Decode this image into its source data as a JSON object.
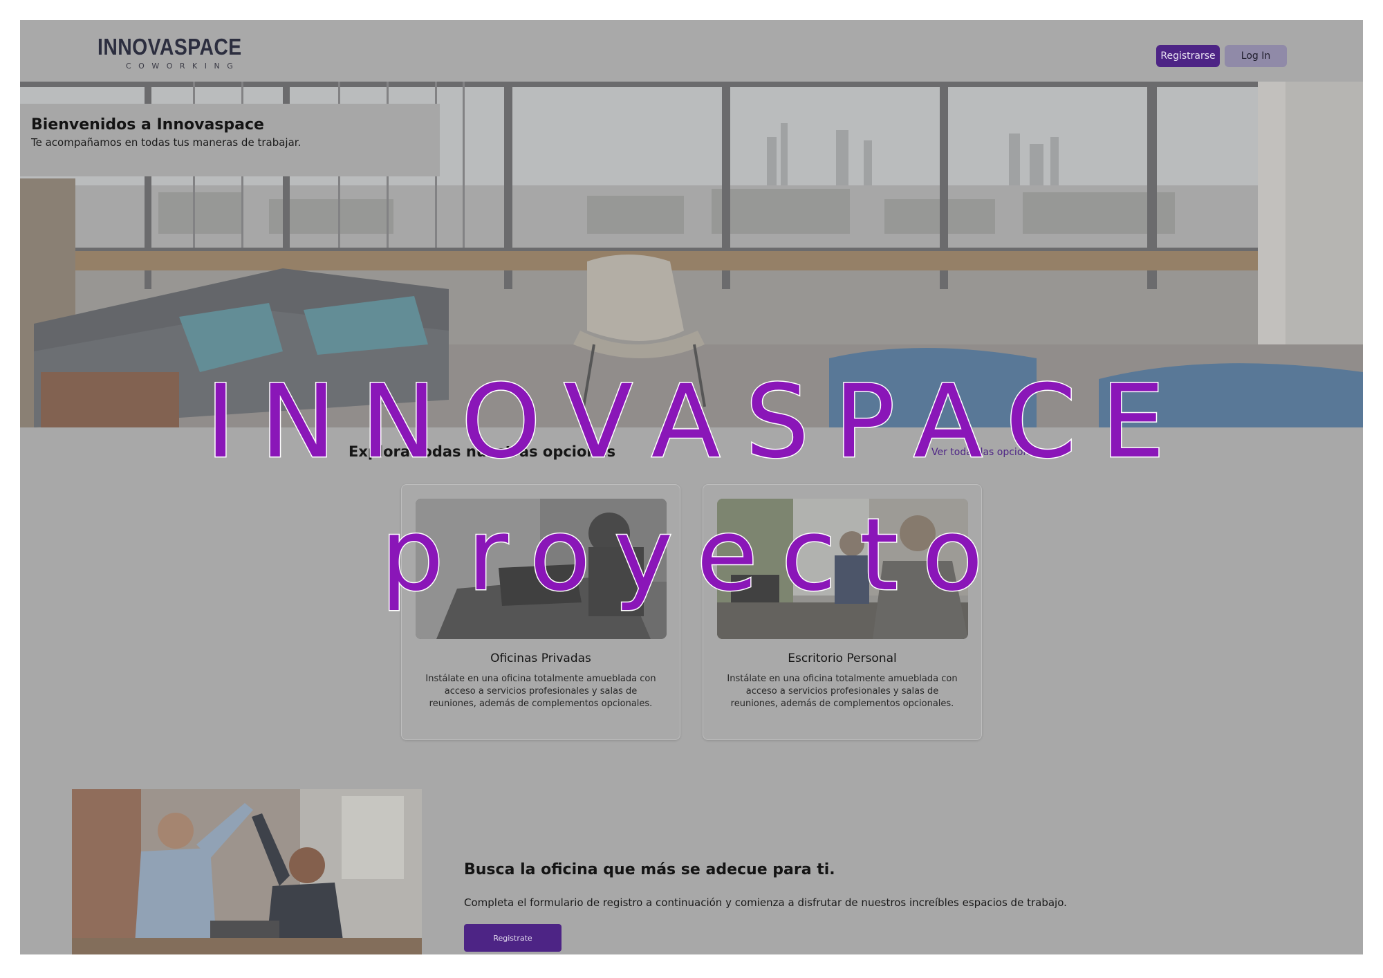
{
  "brand": {
    "name": "INNOVASPACE",
    "tagline": "COWORKING"
  },
  "nav": {
    "register_label": "Registrarse",
    "login_label": "Log In"
  },
  "hero": {
    "title": "Bienvenidos a Innovaspace",
    "subtitle": "Te acompañamos en todas tus maneras de trabajar."
  },
  "options": {
    "title": "Explora todas nuestras opciones",
    "link_label": "Ver todas las opciones",
    "cards": [
      {
        "title": "Oficinas Privadas",
        "description": "Instálate en una oficina totalmente amueblada con acceso a servicios profesionales y salas de reuniones, además de complementos opcionales."
      },
      {
        "title": "Escritorio Personal",
        "description": "Instálate en una oficina totalmente amueblada con acceso a servicios profesionales y salas de reuniones, además de complementos opcionales."
      }
    ]
  },
  "cta": {
    "title": "Busca la oficina que más se adecue para ti.",
    "subtitle": "Completa el formulario de registro a continuación y comienza a disfrutar de nuestros increíbles espacios de trabajo.",
    "button_label": "Registrate"
  },
  "watermark": {
    "line1": "INNOVASPACE",
    "line2": "proyecto"
  },
  "colors": {
    "accent": "#4d2485",
    "watermark": "#8a16b8",
    "overlay": "#a8a8a8"
  }
}
